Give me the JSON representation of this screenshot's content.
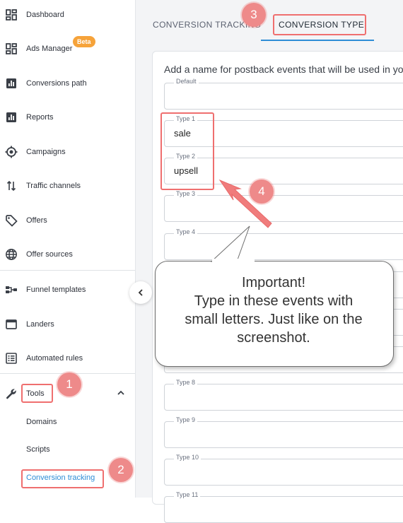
{
  "sidebar": {
    "items": [
      {
        "label": "Dashboard",
        "icon": "dashboard-icon"
      },
      {
        "label": "Ads Manager",
        "icon": "ads-manager-icon",
        "badge": "Beta"
      },
      {
        "label": "Conversions path",
        "icon": "bar-chart-icon"
      },
      {
        "label": "Reports",
        "icon": "reports-icon"
      },
      {
        "label": "Campaigns",
        "icon": "target-icon"
      },
      {
        "label": "Traffic channels",
        "icon": "swap-arrows-icon"
      },
      {
        "label": "Offers",
        "icon": "tag-icon"
      },
      {
        "label": "Offer sources",
        "icon": "globe-icon"
      },
      {
        "label": "Funnel templates",
        "icon": "funnel-icon"
      },
      {
        "label": "Landers",
        "icon": "window-icon"
      },
      {
        "label": "Automated rules",
        "icon": "list-icon"
      },
      {
        "label": "Tools",
        "icon": "wrench-icon"
      }
    ],
    "sub_items": [
      "Domains",
      "Scripts",
      "Conversion tracking"
    ]
  },
  "tabs": [
    "CONVERSION TRACKING",
    "CONVERSION TYPE"
  ],
  "form": {
    "intro": "Add a name for postback events that will be used in yo",
    "fields": [
      {
        "label": "Default",
        "value": ""
      },
      {
        "label": "Type 1",
        "value": "sale"
      },
      {
        "label": "Type 2",
        "value": "upsell"
      },
      {
        "label": "Type 3",
        "value": ""
      },
      {
        "label": "Type 4",
        "value": ""
      },
      {
        "label": "Type 8",
        "value": ""
      },
      {
        "label": "Type 9",
        "value": ""
      },
      {
        "label": "Type 10",
        "value": ""
      },
      {
        "label": "Type 11",
        "value": ""
      }
    ]
  },
  "markers": [
    "1",
    "2",
    "3",
    "4"
  ],
  "callout": {
    "line1": "Important!",
    "line2": "Type in these events with",
    "line3": "small letters. Just like on the",
    "line4": "screenshot."
  },
  "colors": {
    "accent_blue": "#2f8ed6",
    "highlight_red": "#ef6f6f",
    "marker_pink": "#ee8a8a",
    "badge_orange": "#f6a33a"
  }
}
